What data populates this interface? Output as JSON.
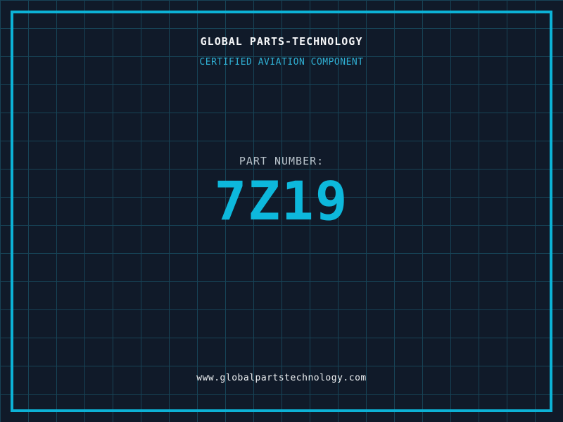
{
  "company": {
    "name": "GLOBAL PARTS-TECHNOLOGY",
    "tagline": "CERTIFIED AVIATION COMPONENT",
    "website": "www.globalpartstechnology.com"
  },
  "part": {
    "label": "PART NUMBER:",
    "number": "7Z19"
  },
  "colors": {
    "background": "#101a29",
    "grid": "#174356",
    "border": "#0cb2d6",
    "accent": "#2fb0d4",
    "number": "#0db8dc",
    "title": "#f5f6f8",
    "label": "#b9c3cb",
    "url": "#edf0f2"
  }
}
